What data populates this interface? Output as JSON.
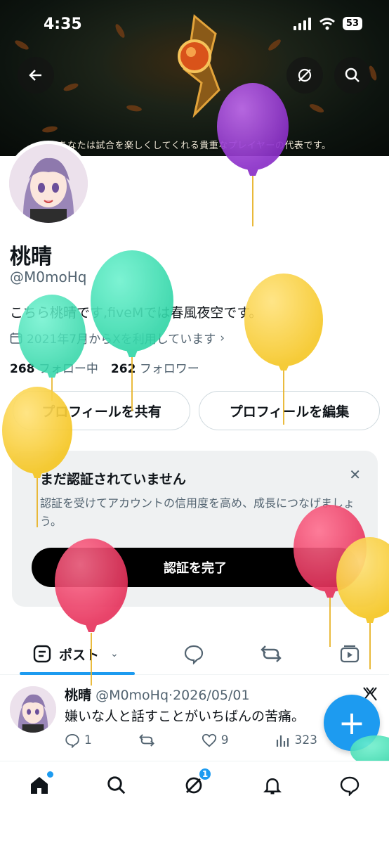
{
  "status_bar": {
    "time": "4:35",
    "battery": "53"
  },
  "banner": {
    "caption_main": "あなたは試合を楽しくしてくれる貴重な",
    "caption_highlight": "プレイヤー",
    "caption_end": "の代表です。"
  },
  "profile": {
    "name": "桃晴",
    "handle": "@M0moHq",
    "bio": "こちら桃晴です,fiveMでは春風夜空です。",
    "joined": "2021年7月からXを利用しています",
    "following_count": "268",
    "following_label": "フォロー中",
    "followers_count": "262",
    "followers_label": "フォロワー"
  },
  "actions": {
    "share": "プロフィールを共有",
    "edit": "プロフィールを編集"
  },
  "verify": {
    "title": "まだ認証されていません",
    "text": "認証を受けてアカウントの信用度を高め、成長につなげましょう。",
    "button": "認証を完了"
  },
  "tabs": {
    "posts": "ポスト"
  },
  "post": {
    "name": "桃晴",
    "handle": "@M0moHq",
    "date": "2026/05/01",
    "body": "嫌いな人と話すことがいちばんの苦痛。",
    "replies": "1",
    "likes": "9",
    "views": "323"
  },
  "nav": {
    "messages_badge": "1"
  },
  "colors": {
    "accent": "#1d9bf0",
    "text": "#0f1419",
    "muted": "#536471"
  }
}
